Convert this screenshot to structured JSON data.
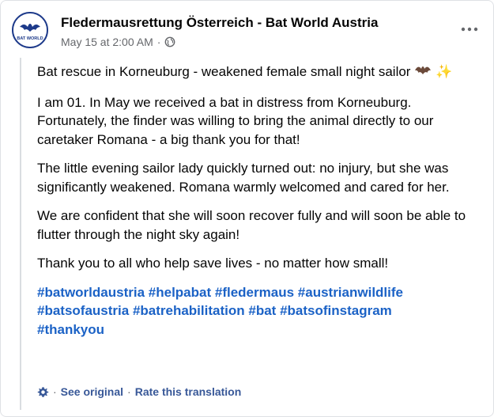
{
  "header": {
    "page_name": "Fledermausrettung Österreich - Bat World Austria",
    "timestamp": "May 15 at 2:00 AM",
    "separator": "·",
    "avatar_text": "BAT WORLD",
    "avatar_icon": "bat-logo",
    "privacy_icon": "globe-icon",
    "more_icon": "more-dots-icon"
  },
  "post": {
    "title_text": "Bat rescue in Korneuburg - weakened female small night sailor",
    "title_emoji_1": "bat-emoji",
    "title_emoji_2": "✨",
    "paragraphs": [
      "I am 01. In May we received a bat in distress from Korneuburg. Fortunately, the finder was willing to bring the animal directly to our caretaker Romana - a big thank you for that!",
      "The little evening sailor lady quickly turned out: no injury, but she was significantly weakened. Romana warmly welcomed and cared for her.",
      "We are confident that she will soon recover fully and will soon be able to flutter through the night sky again!",
      "Thank you to all who help save lives - no matter how small!"
    ],
    "hashtags": [
      "#batworldaustria",
      "#helpabat",
      "#fledermaus",
      "#austrianwildlife",
      "#batsofaustria",
      "#batrehabilitation",
      "#bat",
      "#batsofinstagram",
      "#thankyou"
    ]
  },
  "translation": {
    "icon": "gear-icon",
    "see_original": "See original",
    "separator": "·",
    "rate": "Rate this translation"
  },
  "colors": {
    "link": "#1b62c6",
    "meta": "#65676b",
    "border": "#dadde1"
  }
}
